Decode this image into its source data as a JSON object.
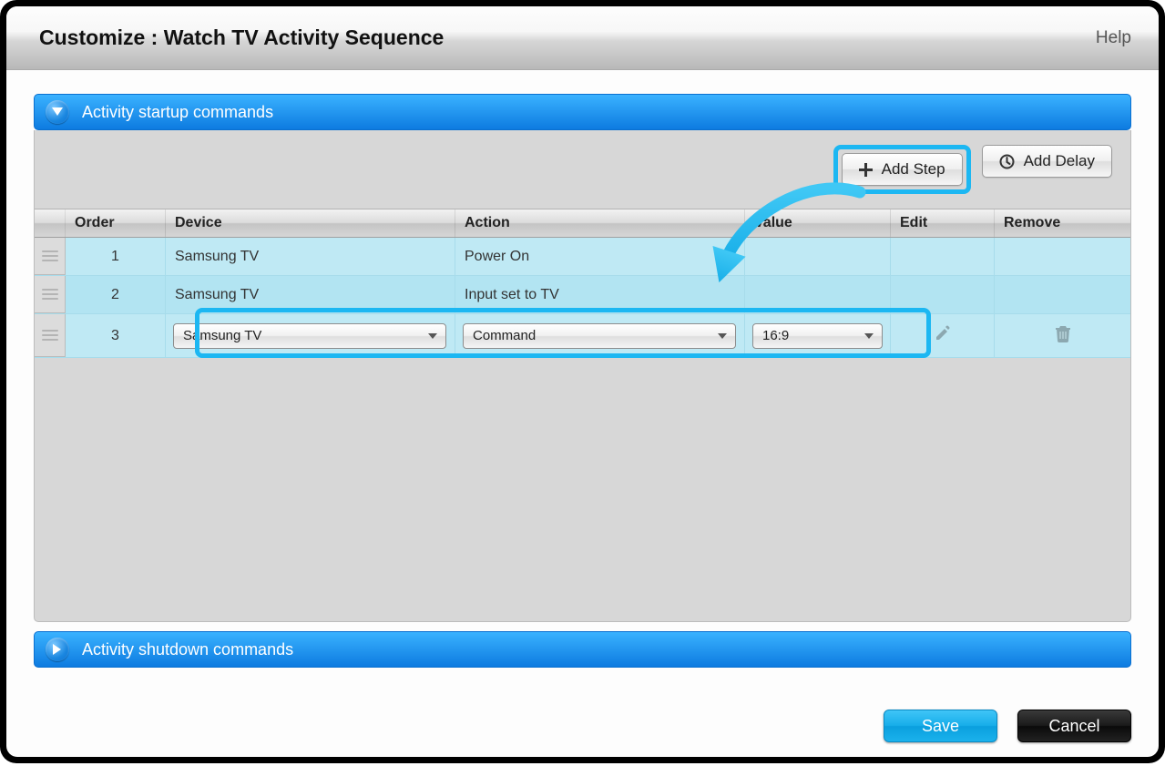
{
  "titlebar": {
    "title": "Customize : Watch TV Activity Sequence",
    "help": "Help"
  },
  "startup_panel": {
    "title": "Activity startup commands",
    "add_step": "Add Step",
    "add_delay": "Add Delay",
    "columns": {
      "order": "Order",
      "device": "Device",
      "action": "Action",
      "value": "Value",
      "edit": "Edit",
      "remove": "Remove"
    },
    "rows": [
      {
        "order": "1",
        "device": "Samsung TV",
        "action": "Power On",
        "value": ""
      },
      {
        "order": "2",
        "device": "Samsung TV",
        "action": "Input set to TV",
        "value": ""
      },
      {
        "order": "3",
        "device": "Samsung TV",
        "action": "Command",
        "value": "16:9"
      }
    ]
  },
  "shutdown_panel": {
    "title": "Activity shutdown commands"
  },
  "footer": {
    "save": "Save",
    "cancel": "Cancel"
  }
}
